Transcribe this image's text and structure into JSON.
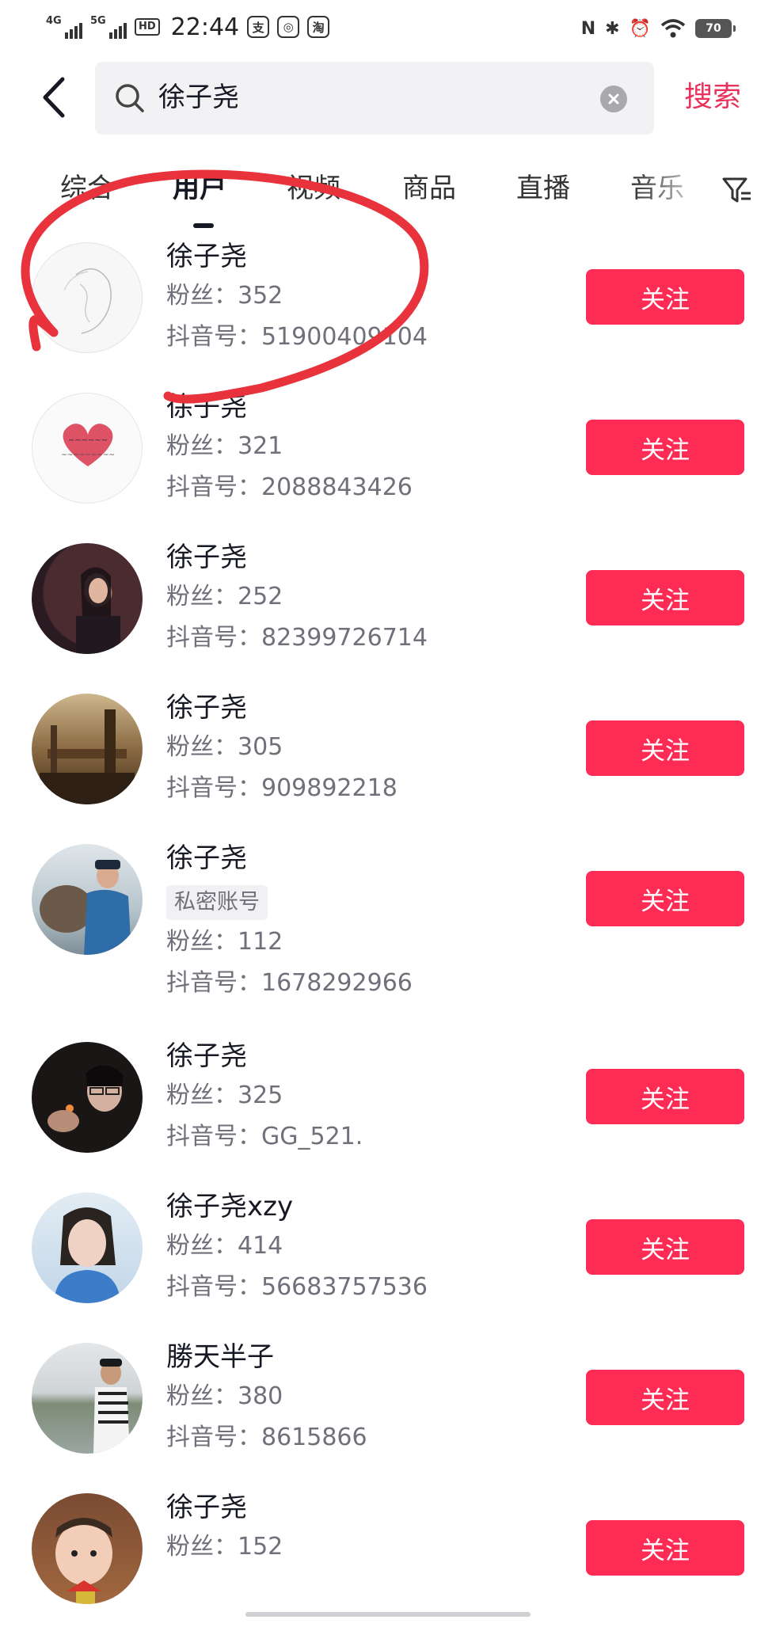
{
  "status_bar": {
    "signal1": "4G",
    "signal2": "5G",
    "hd": "HD",
    "time": "22:44",
    "app_icons": [
      "支",
      "◎",
      "淘"
    ],
    "right_icons": [
      "N",
      "✱",
      "⏰",
      "wifi"
    ],
    "battery": "70"
  },
  "header": {
    "search_query": "徐子尧",
    "search_button": "搜索"
  },
  "tabs": [
    {
      "label": "综合",
      "active": false
    },
    {
      "label": "用户",
      "active": true
    },
    {
      "label": "视频",
      "active": false
    },
    {
      "label": "商品",
      "active": false
    },
    {
      "label": "直播",
      "active": false
    },
    {
      "label": "音乐",
      "active": false
    }
  ],
  "follow_label": "关注",
  "users": [
    {
      "name": "徐子尧",
      "fans": "粉丝：352",
      "douyin_id": "抖音号：51900409104",
      "badge": "",
      "avatar": "line-sketch-woman"
    },
    {
      "name": "徐子尧",
      "fans": "粉丝：321",
      "douyin_id": "抖音号：2088843426",
      "badge": "",
      "avatar": "red-heart-calligraphy"
    },
    {
      "name": "徐子尧",
      "fans": "粉丝：252",
      "douyin_id": "抖音号：82399726714",
      "badge": "",
      "avatar": "woman-singing"
    },
    {
      "name": "徐子尧",
      "fans": "粉丝：305",
      "douyin_id": "抖音号：909892218",
      "badge": "",
      "avatar": "rustic-wood-scene"
    },
    {
      "name": "徐子尧",
      "fans": "粉丝：112",
      "douyin_id": "抖音号：1678292966",
      "badge": "私密账号",
      "avatar": "man-with-bear"
    },
    {
      "name": "徐子尧",
      "fans": "粉丝：325",
      "douyin_id": "抖音号：GG_521.",
      "badge": "",
      "avatar": "couple-dark"
    },
    {
      "name": "徐子尧xzy",
      "fans": "粉丝：414",
      "douyin_id": "抖音号：56683757536",
      "badge": "",
      "avatar": "woman-selfie"
    },
    {
      "name": "勝天半子",
      "fans": "粉丝：380",
      "douyin_id": "抖音号：8615866",
      "badge": "",
      "avatar": "man-by-lake"
    },
    {
      "name": "徐子尧",
      "fans": "粉丝：152",
      "douyin_id": "",
      "badge": "",
      "avatar": "child-portrait"
    }
  ],
  "colors": {
    "accent": "#fe2c55",
    "search_accent": "#e8325c",
    "annotation": "#e8323c"
  }
}
